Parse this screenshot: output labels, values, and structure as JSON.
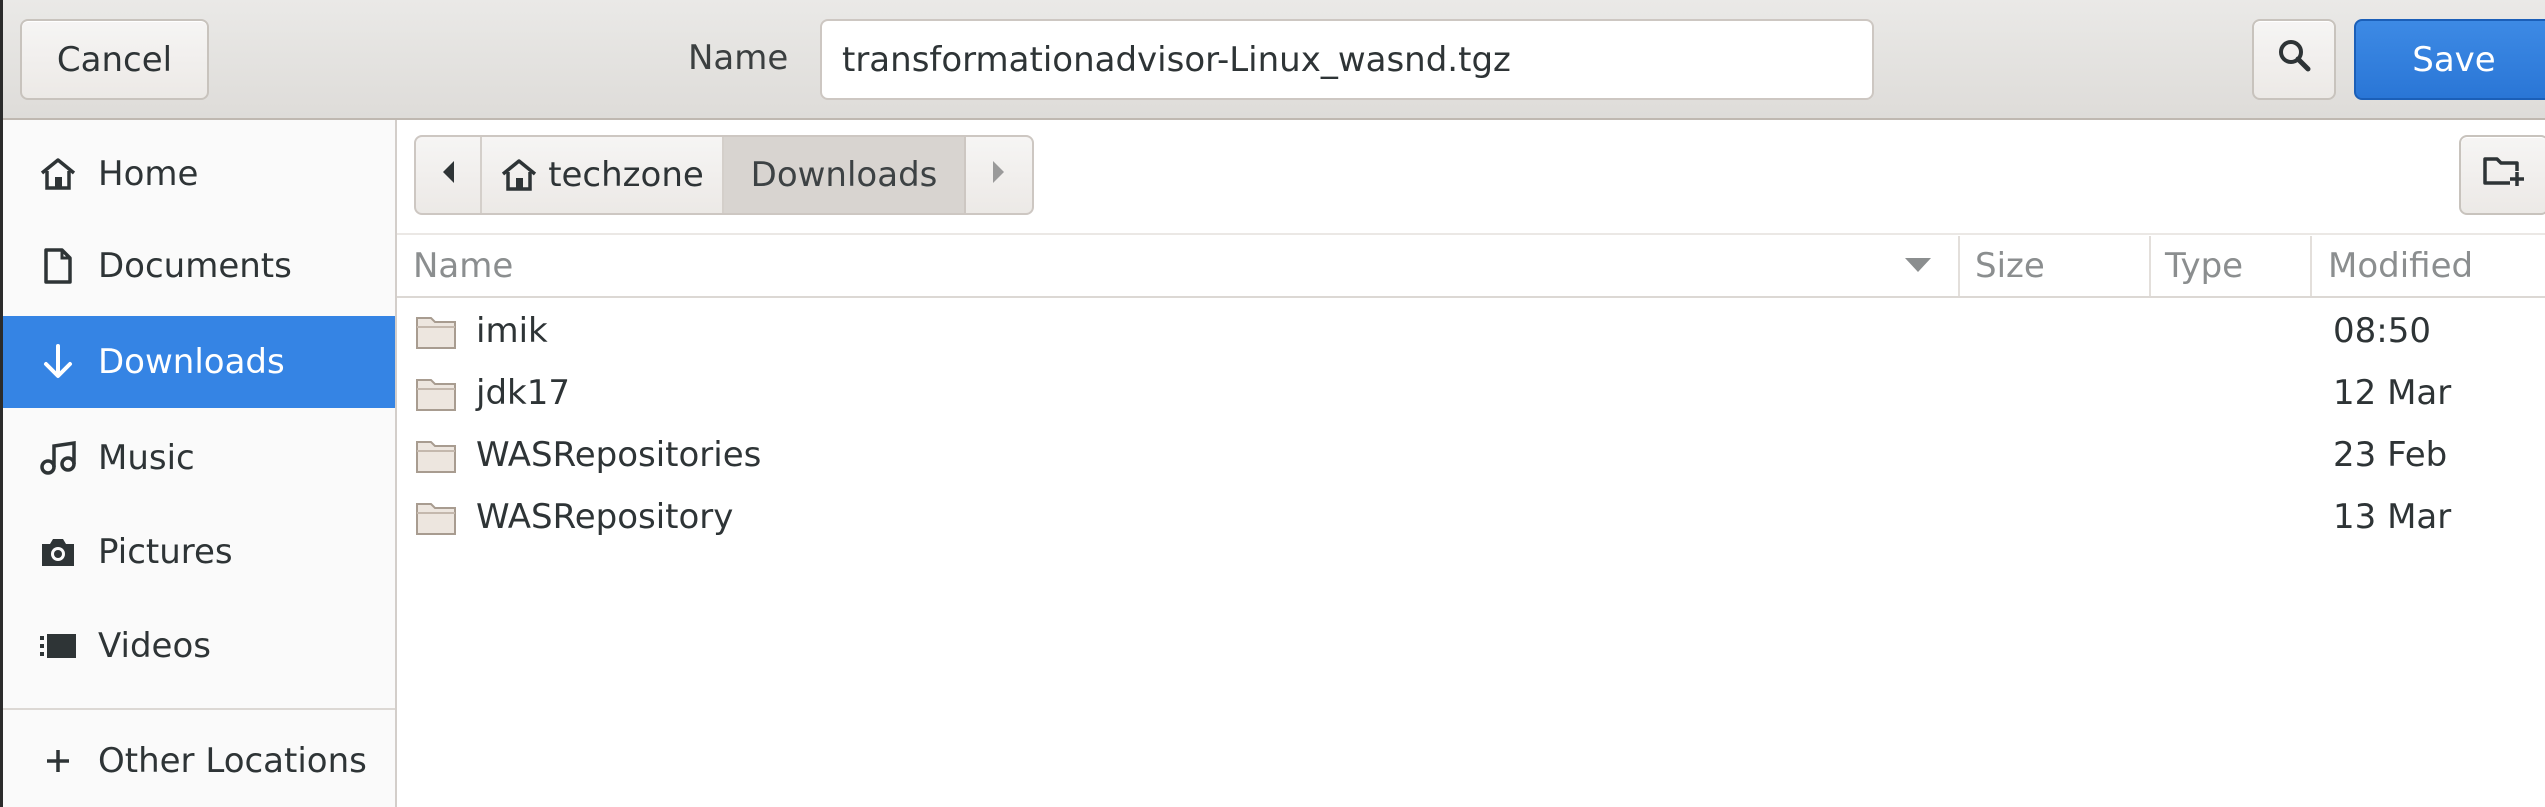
{
  "header": {
    "cancel_label": "Cancel",
    "name_label": "Name",
    "filename_value": "transformationadvisor-Linux_wasnd.tgz",
    "search_icon": "search-icon",
    "save_label": "Save"
  },
  "sidebar": {
    "items": [
      {
        "label": "Home",
        "icon": "home-icon"
      },
      {
        "label": "Documents",
        "icon": "document-icon"
      },
      {
        "label": "Downloads",
        "icon": "download-icon",
        "active": true
      },
      {
        "label": "Music",
        "icon": "music-icon"
      },
      {
        "label": "Pictures",
        "icon": "camera-icon"
      },
      {
        "label": "Videos",
        "icon": "video-icon"
      },
      {
        "label": "Other Locations",
        "icon": "plus-icon"
      }
    ]
  },
  "pathbar": {
    "segments": [
      "techzone",
      "Downloads"
    ],
    "active": "Downloads"
  },
  "columns": {
    "name": "Name",
    "size": "Size",
    "type": "Type",
    "modified": "Modified"
  },
  "files": [
    {
      "name": "imik",
      "modified": "08:50"
    },
    {
      "name": "jdk17",
      "modified": "12 Mar"
    },
    {
      "name": "WASRepositories",
      "modified": "23 Feb"
    },
    {
      "name": "WASRepository",
      "modified": "13 Mar"
    }
  ],
  "colors": {
    "accent": "#3584e4",
    "save_button": "#2a76d6",
    "header_bg": "#e4e2df"
  }
}
